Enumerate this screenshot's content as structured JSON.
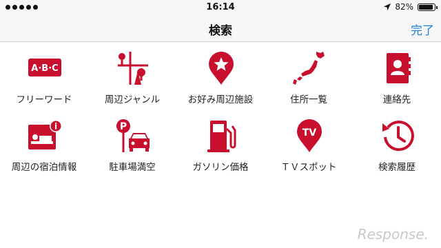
{
  "status": {
    "time": "16:14",
    "battery_label": "82%",
    "battery_level": 0.82
  },
  "nav": {
    "title": "検索",
    "done_label": "完了"
  },
  "accent_color": "#c8102e",
  "items": [
    {
      "label": "フリーワード",
      "icon": "abc-keyboard-icon",
      "icon_text": "A·B·C"
    },
    {
      "label": "周辺ジャンル",
      "icon": "map-pins-icon"
    },
    {
      "label": "お好み周辺施設",
      "icon": "star-pin-icon"
    },
    {
      "label": "住所一覧",
      "icon": "japan-map-icon"
    },
    {
      "label": "連絡先",
      "icon": "contacts-book-icon"
    },
    {
      "label": "周辺の宿泊情報",
      "icon": "hotel-bed-icon",
      "icon_text": "i"
    },
    {
      "label": "駐車場満空",
      "icon": "parking-car-icon",
      "icon_text": "P"
    },
    {
      "label": "ガソリン価格",
      "icon": "fuel-pump-icon"
    },
    {
      "label": "ＴＶスポット",
      "icon": "tv-pin-icon",
      "icon_text": "TV"
    },
    {
      "label": "検索履歴",
      "icon": "history-clock-icon"
    }
  ],
  "watermark": "Response."
}
